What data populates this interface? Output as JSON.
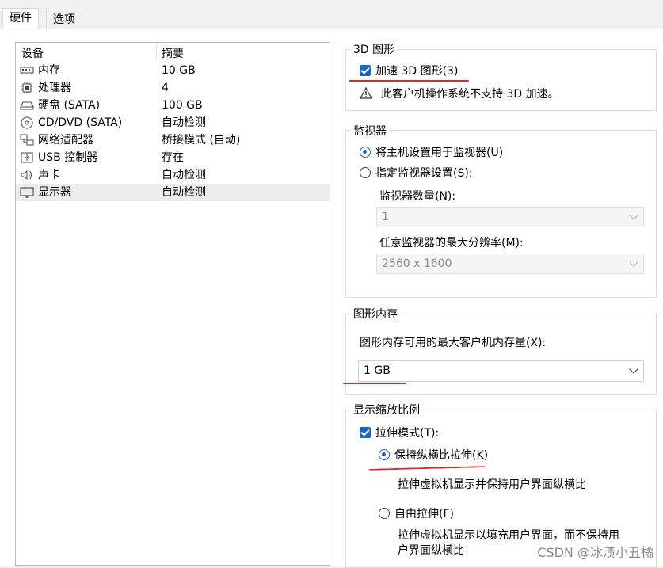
{
  "tabs": [
    "硬件",
    "选项"
  ],
  "device_list": {
    "headers": [
      "设备",
      "摘要"
    ],
    "rows": [
      {
        "name": "内存",
        "summary": "10 GB",
        "icon": "memory-icon"
      },
      {
        "name": "处理器",
        "summary": "4",
        "icon": "cpu-icon"
      },
      {
        "name": "硬盘 (SATA)",
        "summary": "100 GB",
        "icon": "disk-icon"
      },
      {
        "name": "CD/DVD (SATA)",
        "summary": "自动检测",
        "icon": "cd-icon"
      },
      {
        "name": "网络适配器",
        "summary": "桥接模式 (自动)",
        "icon": "network-icon"
      },
      {
        "name": "USB 控制器",
        "summary": "存在",
        "icon": "usb-icon"
      },
      {
        "name": "声卡",
        "summary": "自动检测",
        "icon": "speaker-icon"
      },
      {
        "name": "显示器",
        "summary": "自动检测",
        "icon": "monitor-icon"
      }
    ]
  },
  "graphics3d": {
    "title": "3D 图形",
    "accelerate_label": "加速 3D 图形(3)",
    "accelerate_checked": true,
    "warning": "此客户机操作系统不支持 3D 加速。"
  },
  "monitor": {
    "title": "监视器",
    "use_host_label": "将主机设置用于监视器(U)",
    "specify_label": "指定监视器设置(S):",
    "count_label": "监视器数量(N):",
    "count_value": "1",
    "maxres_label": "任意监视器的最大分辨率(M):",
    "maxres_value": "2560 x 1600"
  },
  "graphics_memory": {
    "title": "图形内存",
    "label": "图形内存可用的最大客户机内存量(X):",
    "value": "1 GB"
  },
  "display_scaling": {
    "title": "显示缩放比例",
    "stretch_label": "拉伸模式(T):",
    "stretch_checked": true,
    "keep_ratio_label": "保持纵横比拉伸(K)",
    "keep_ratio_desc": "拉伸虚拟机显示并保持用户界面纵横比",
    "free_label": "自由拉伸(F)",
    "free_desc_1": "拉伸虚拟机显示以填充用户界面，而不保持用",
    "free_desc_2": "户界面纵横比"
  },
  "watermark": "CSDN @冰渍小丑橘",
  "colors": {
    "accent": "#1a66c2",
    "annotation_red": "#e8242a"
  }
}
